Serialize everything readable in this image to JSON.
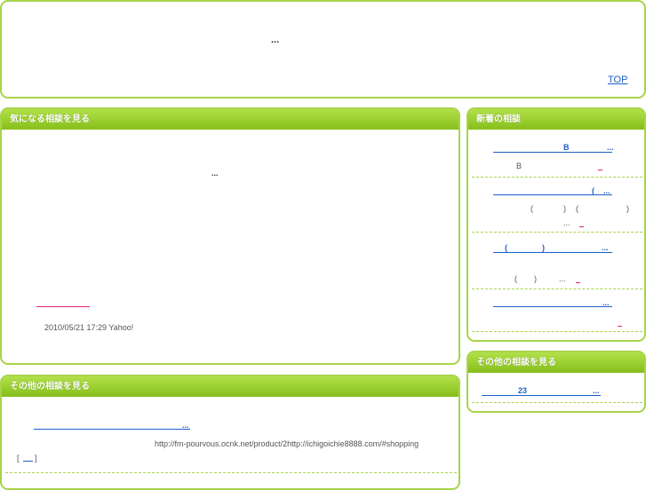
{
  "header": {
    "title": "...",
    "top_link": "TOP"
  },
  "main_panel": {
    "heading": "気になる相談を見る",
    "body_text": "...",
    "meta": "2010/05/21 17:29 Yahoo!"
  },
  "other_panel": {
    "heading": "その他の相談を見る",
    "link_text": "...",
    "url_text": "http://fm-pourvous.ocnk.net/product/2http://ichigoichie8888.com/#shopping",
    "bracket_left": "[",
    "bracket_right": "]"
  },
  "new_panel": {
    "heading": "新着の相談",
    "items": [
      {
        "title_a": "B",
        "title_b": "...",
        "desc": "B"
      },
      {
        "title_a": "(",
        "title_b": "...",
        "desc_a": "(",
        "desc_b": ")",
        "desc_c": "(",
        "desc_d": ")",
        "desc_e": "..."
      },
      {
        "title_a": "(",
        "title_b": ")",
        "title_c": "...",
        "desc_a": "(",
        "desc_b": ")",
        "desc_c": "..."
      },
      {
        "title_a": "..."
      }
    ]
  },
  "side_other_panel": {
    "heading": "その他の相談を見る",
    "link_a": "23",
    "link_b": "..."
  },
  "colors": {
    "accent_green": "#a8d44a",
    "link_blue": "#1e5fc8",
    "pink": "#e0207a"
  }
}
